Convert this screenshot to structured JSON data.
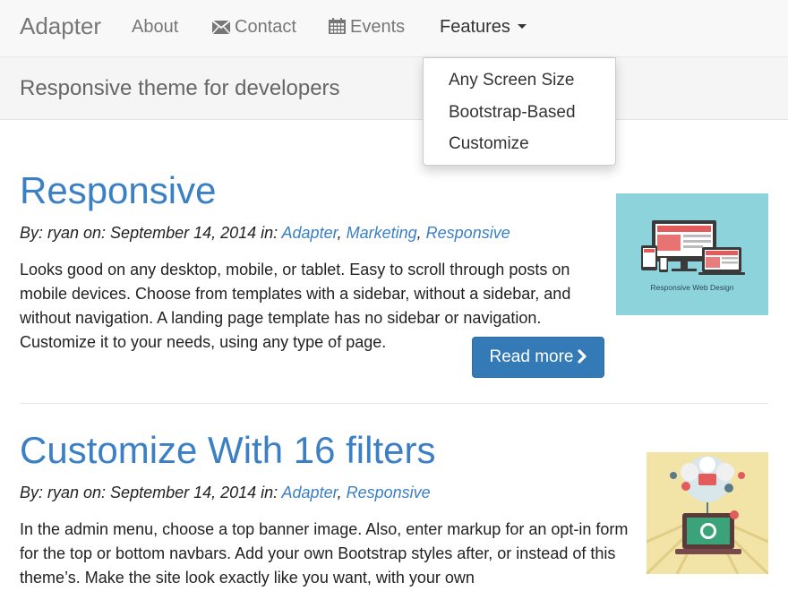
{
  "navbar": {
    "brand": "Adapter",
    "items": [
      {
        "label": "About",
        "icon": ""
      },
      {
        "label": "Contact",
        "icon": "envelope-icon"
      },
      {
        "label": "Events",
        "icon": "calendar-icon"
      },
      {
        "label": "Features",
        "icon": "caret-down-icon"
      }
    ]
  },
  "tagline": "Responsive theme for developers",
  "dropdown": {
    "items": [
      "Any Screen Size",
      "Bootstrap-Based",
      "Customize"
    ]
  },
  "posts": [
    {
      "title": "Responsive",
      "meta_prefix": "By: ryan on: September 14, 2014 in:",
      "categories": [
        "Adapter",
        "Marketing",
        "Responsive"
      ],
      "excerpt": "Looks good on any desktop, mobile, or tablet. Easy to scroll through posts on mobile devices. Choose from templates with a sidebar, without a sidebar, and without navigation. A landing page template has no sidebar or navigation. Customize it to your needs, using any type of page.",
      "read_more": "Read more",
      "thumb_caption": "Responsive Web Design"
    },
    {
      "title": "Customize With 16 filters",
      "meta_prefix": "By: ryan on: September 14, 2014 in:",
      "categories": [
        "Adapter",
        "Responsive"
      ],
      "excerpt": "In the admin menu, choose a top banner image. Also, enter markup for an opt-in form for the top or bottom navbars. Add your own Bootstrap styles after, or instead of this theme’s. Make the site look exactly like you want, with your own"
    }
  ],
  "colors": {
    "link": "#3b7fc4",
    "button": "#337ab7",
    "thumb1_bg": "#8dd3dc",
    "thumb2_bg": "#f2e3a6"
  }
}
